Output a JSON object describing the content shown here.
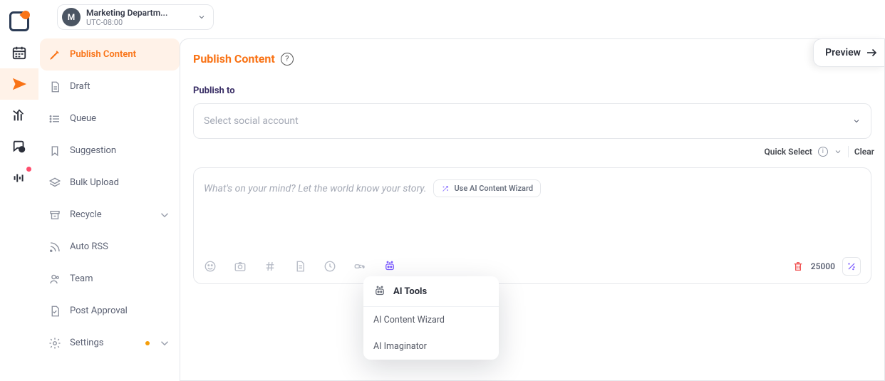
{
  "workspace": {
    "avatar_letter": "M",
    "name": "Marketing Departm...",
    "timezone": "UTC-08:00"
  },
  "sidebar": {
    "items": [
      {
        "label": "Publish Content"
      },
      {
        "label": "Draft"
      },
      {
        "label": "Queue"
      },
      {
        "label": "Suggestion"
      },
      {
        "label": "Bulk Upload"
      },
      {
        "label": "Recycle"
      },
      {
        "label": "Auto RSS"
      },
      {
        "label": "Team"
      },
      {
        "label": "Post Approval"
      },
      {
        "label": "Settings"
      }
    ]
  },
  "page": {
    "heading": "Publish Content",
    "preview_label": "Preview",
    "publish_to_label": "Publish to",
    "select_placeholder": "Select social account",
    "quick_select_label": "Quick Select",
    "clear_label": "Clear"
  },
  "composer": {
    "placeholder": "What's on your mind? Let the world know your story.",
    "wizard_button": "Use AI Content Wizard",
    "char_limit": "25000"
  },
  "popover": {
    "title": "AI Tools",
    "items": [
      "AI Content Wizard",
      "AI Imaginator"
    ]
  }
}
